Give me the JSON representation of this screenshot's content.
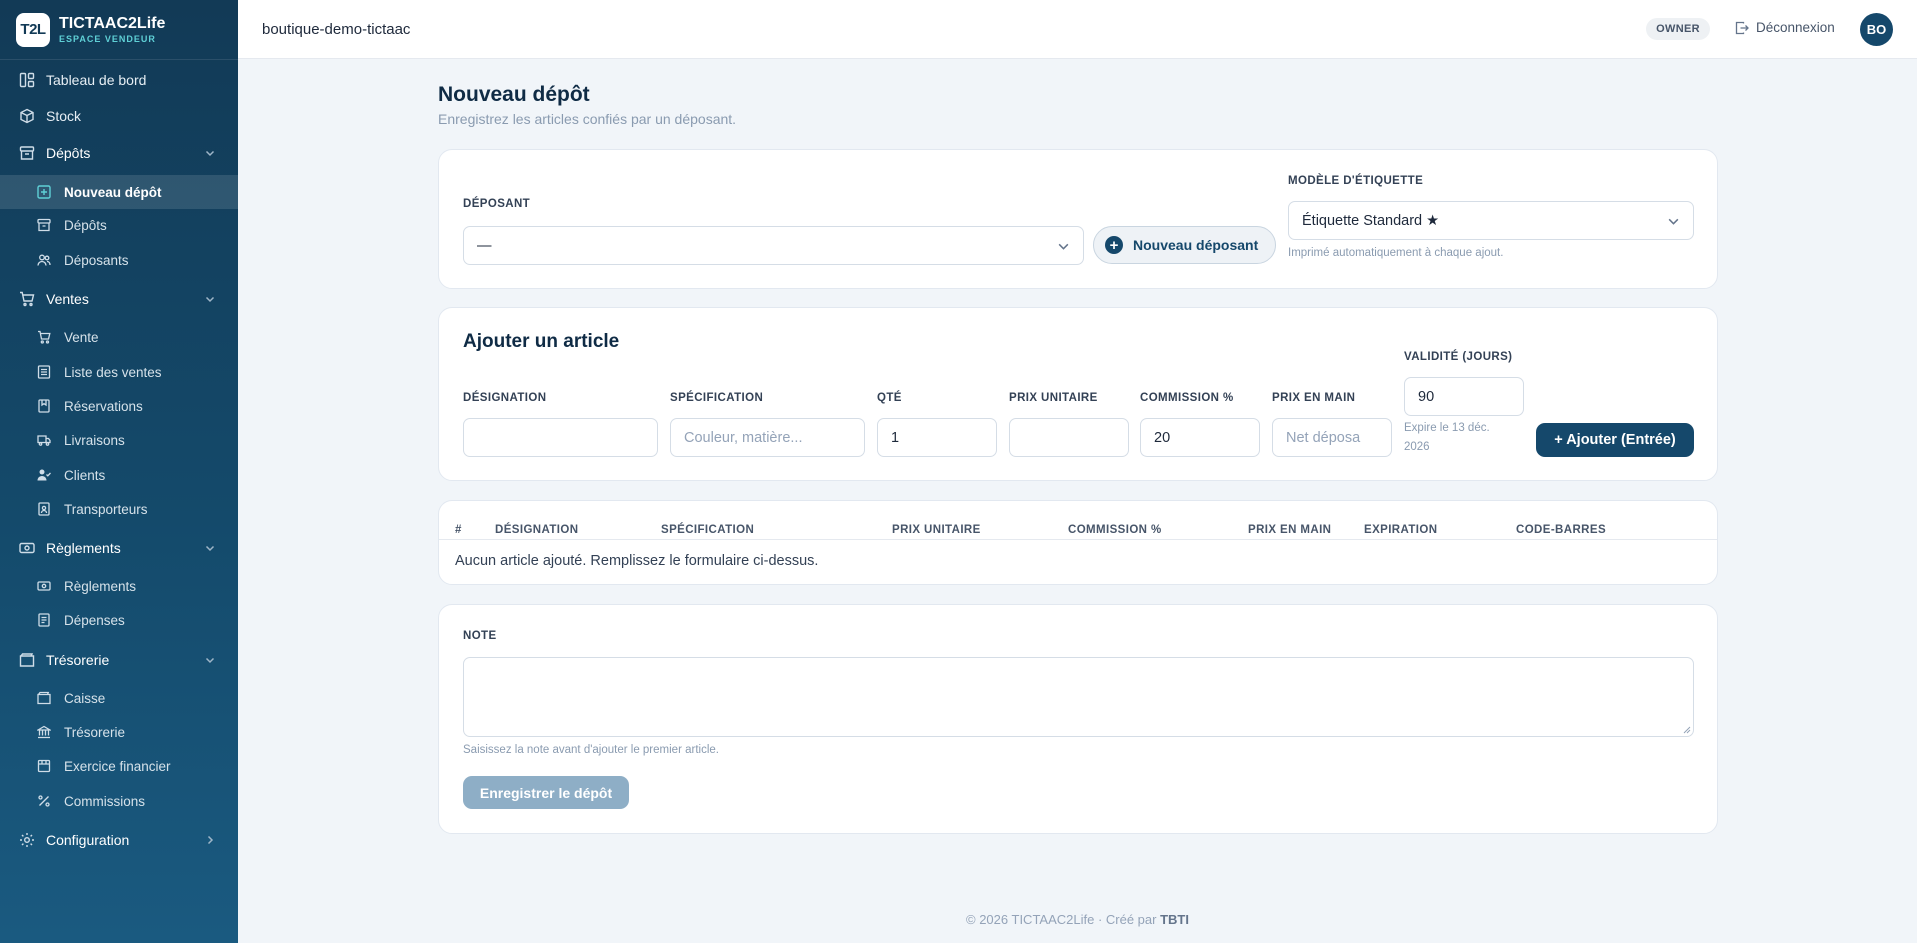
{
  "brand": {
    "logo": "T2L",
    "name": "TICTAAC2Life",
    "subtitle": "ESPACE VENDEUR"
  },
  "sidebar": {
    "items": [
      {
        "label": "Tableau de bord",
        "icon": "dashboard-icon"
      },
      {
        "label": "Stock",
        "icon": "box-icon"
      },
      {
        "label": "Dépôts",
        "icon": "archive-icon",
        "expanded": true
      },
      {
        "label": "Nouveau dépôt",
        "icon": "plus-square-icon",
        "active": true
      },
      {
        "label": "Dépôts",
        "icon": "archive-icon"
      },
      {
        "label": "Déposants",
        "icon": "users-icon"
      },
      {
        "label": "Ventes",
        "icon": "cart-icon",
        "expanded": true
      },
      {
        "label": "Vente",
        "icon": "cart-icon"
      },
      {
        "label": "Liste des ventes",
        "icon": "list-icon"
      },
      {
        "label": "Réservations",
        "icon": "bookmark-icon"
      },
      {
        "label": "Livraisons",
        "icon": "truck-icon"
      },
      {
        "label": "Clients",
        "icon": "user-check-icon"
      },
      {
        "label": "Transporteurs",
        "icon": "badge-icon"
      },
      {
        "label": "Règlements",
        "icon": "banknote-icon",
        "expanded": true
      },
      {
        "label": "Règlements",
        "icon": "banknote-icon"
      },
      {
        "label": "Dépenses",
        "icon": "receipt-icon"
      },
      {
        "label": "Trésorerie",
        "icon": "wallet-icon",
        "expanded": true
      },
      {
        "label": "Caisse",
        "icon": "wallet-icon"
      },
      {
        "label": "Trésorerie",
        "icon": "bank-icon"
      },
      {
        "label": "Exercice financier",
        "icon": "calendar-icon"
      },
      {
        "label": "Commissions",
        "icon": "percent-icon"
      },
      {
        "label": "Configuration",
        "icon": "gear-icon",
        "expanded": false
      }
    ]
  },
  "topbar": {
    "shop": "boutique-demo-tictaac",
    "role": "OWNER",
    "logout": "Déconnexion",
    "avatar": "BO"
  },
  "page": {
    "title": "Nouveau dépôt",
    "subtitle": "Enregistrez les articles confiés par un déposant."
  },
  "depositor": {
    "label": "DÉPOSANT",
    "value": "—",
    "new_button": "Nouveau déposant",
    "template_label": "MODÈLE D'ÉTIQUETTE",
    "template_value": "Étiquette Standard ★",
    "template_hint": "Imprimé automatiquement à chaque ajout."
  },
  "article": {
    "title": "Ajouter un article",
    "designation_label": "DÉSIGNATION",
    "designation_value": "",
    "spec_label": "SPÉCIFICATION",
    "spec_placeholder": "Couleur, matière...",
    "qty_label": "QTÉ",
    "qty_value": "1",
    "price_label": "PRIX UNITAIRE",
    "price_value": "",
    "commission_label": "COMMISSION %",
    "commission_value": "20",
    "net_label": "PRIX EN MAIN",
    "net_placeholder": "Net déposa",
    "validity_label": "VALIDITÉ (JOURS)",
    "validity_value": "90",
    "expiry_hint_1": "Expire le 13 déc.",
    "expiry_hint_2": "2026",
    "add_button": "+  Ajouter (Entrée)"
  },
  "table": {
    "headers": [
      "#",
      "DÉSIGNATION",
      "SPÉCIFICATION",
      "PRIX UNITAIRE",
      "COMMISSION %",
      "PRIX EN MAIN",
      "EXPIRATION",
      "CODE-BARRES"
    ],
    "empty": "Aucun article ajouté. Remplissez le formulaire ci-dessus."
  },
  "note": {
    "label": "NOTE",
    "value": "",
    "hint": "Saisissez la note avant d'ajouter le premier article.",
    "save_button": "Enregistrer le dépôt"
  },
  "footer": {
    "text": "© 2026 TICTAAC2Life · Créé par ",
    "author": "TBTI"
  },
  "colors": {
    "sidebar": "#123a56",
    "primary": "#15486b",
    "accent": "#5fd0d6",
    "background": "#f1f5f9"
  }
}
